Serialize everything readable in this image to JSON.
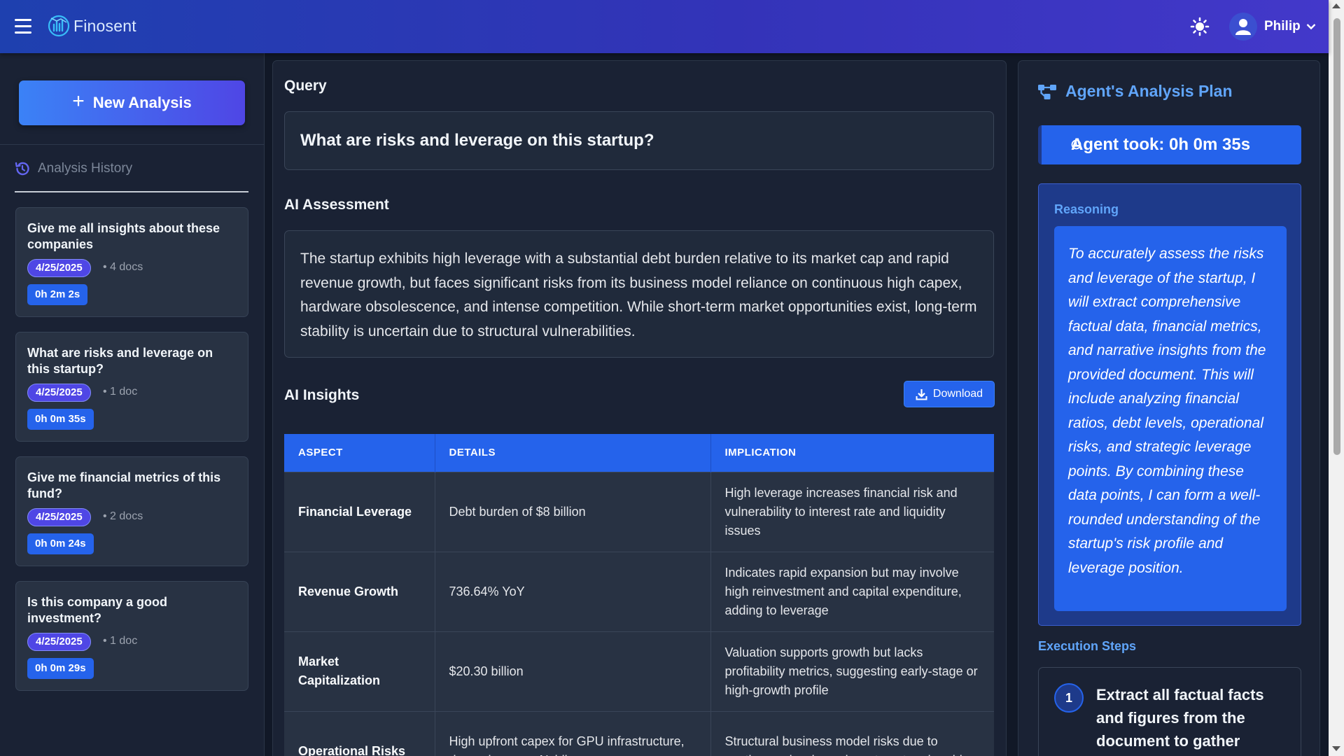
{
  "header": {
    "app_name": "Finosent",
    "user_name": "Philip"
  },
  "sidebar": {
    "new_analysis_label": "New Analysis",
    "history_label": "Analysis History",
    "history": [
      {
        "title": "Give me all insights about these companies",
        "date": "4/25/2025",
        "docs": "• 4 docs",
        "duration": "0h 2m 2s"
      },
      {
        "title": "What are risks and leverage on this startup?",
        "date": "4/25/2025",
        "docs": "• 1 doc",
        "duration": "0h 0m 35s"
      },
      {
        "title": "Give me financial metrics of this fund?",
        "date": "4/25/2025",
        "docs": "• 2 docs",
        "duration": "0h 0m 24s"
      },
      {
        "title": "Is this company a good investment?",
        "date": "4/25/2025",
        "docs": "• 1 doc",
        "duration": "0h 0m 29s"
      }
    ]
  },
  "main": {
    "query_label": "Query",
    "query_text": "What are risks and leverage on this startup?",
    "assessment_label": "AI Assessment",
    "assessment_text": "The startup exhibits high leverage with a substantial debt burden relative to its market cap and rapid revenue growth, but faces significant risks from its business model reliance on continuous high capex, hardware obsolescence, and intense competition. While short-term market opportunities exist, long-term stability is uncertain due to structural vulnerabilities.",
    "insights_label": "AI Insights",
    "download_label": "Download",
    "table": {
      "headers": [
        "ASPECT",
        "DETAILS",
        "IMPLICATION"
      ],
      "rows": [
        {
          "aspect": "Financial Leverage",
          "details": "Debt burden of $8 billion",
          "implication": "High leverage increases financial risk and vulnerability to interest rate and liquidity issues"
        },
        {
          "aspect": "Revenue Growth",
          "details": "736.64% YoY",
          "implication": "Indicates rapid expansion but may involve high reinvestment and capital expenditure, adding to leverage"
        },
        {
          "aspect": "Market Capitalization",
          "details": "$20.30 billion",
          "implication": "Valuation supports growth but lacks profitability metrics, suggesting early-stage or high-growth profile"
        },
        {
          "aspect": "Operational Risks",
          "details": "High upfront capex for GPU infrastructure, dependence on Nvidia",
          "implication": "Structural business model risks due to continuous hardware investment and rapid"
        }
      ]
    }
  },
  "plan": {
    "title": "Agent's Analysis Plan",
    "took_text": "Agent took: 0h 0m 35s",
    "reasoning_label": "Reasoning",
    "reasoning_text": "To accurately assess the risks and leverage of the startup, I will extract comprehensive factual data, financial metrics, and narrative insights from the provided document. This will include analyzing financial ratios, debt levels, operational risks, and strategic leverage points. By combining these data points, I can form a well-rounded understanding of the startup's risk profile and leverage position.",
    "execution_label": "Execution Steps",
    "steps": [
      {
        "number": "1",
        "text": "Extract all factual facts and figures from the document to gather detailed data on"
      }
    ]
  },
  "colors": {
    "accent": "#2563eb",
    "accent_light": "#60a5fa",
    "date_badge": "#4f46e5",
    "background": "#111827",
    "panel": "#1a2234"
  }
}
